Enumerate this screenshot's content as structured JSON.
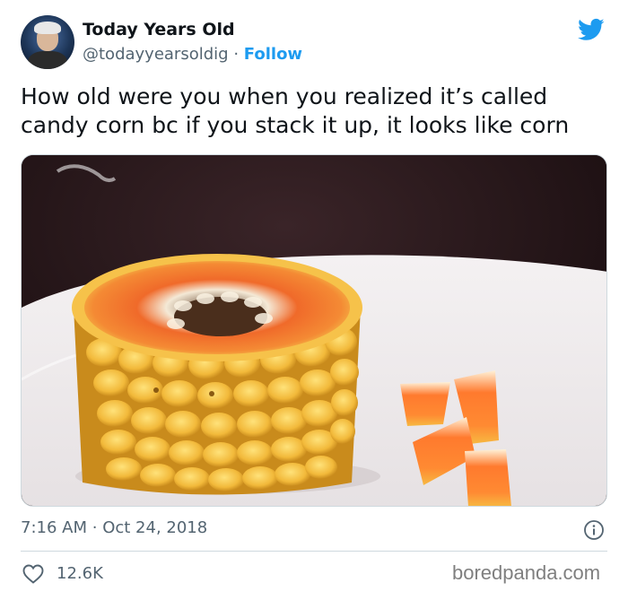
{
  "author": {
    "display_name": "Today Years Old",
    "handle": "@todayyearsoldig",
    "separator": "·",
    "follow_label": "Follow"
  },
  "tweet": {
    "text_line1": "How old were you when you realized it’s called",
    "text_line2": "candy corn bc if you stack it up, it looks like corn",
    "media_alt": "Stacked candy corn arranged to look like a cob of corn on a white plate"
  },
  "meta": {
    "time": "7:16 AM",
    "separator": "·",
    "date": "Oct 24, 2018",
    "like_count": "12.6K"
  },
  "watermark": "boredpanda.com",
  "colors": {
    "accent": "#1d9bf0",
    "secondary_text": "#536471",
    "divider": "#cfd9de"
  },
  "icons": {
    "brand": "twitter-bird-icon",
    "info": "info-icon",
    "like": "heart-icon"
  }
}
